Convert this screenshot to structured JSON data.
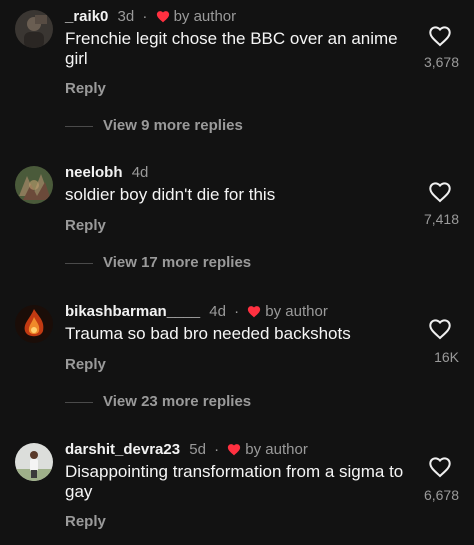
{
  "colors": {
    "background": "#121212",
    "author_heart": "#ff3040",
    "muted": "#9a9a9a"
  },
  "icons": {
    "like": "heart-outline-icon",
    "author_like": "heart-filled-icon"
  },
  "comments": [
    {
      "username": "_raik0",
      "time": "3d",
      "separator": "·",
      "by_author": "by author",
      "text": "Frenchie legit chose the BBC over an anime girl",
      "likes": "3,678",
      "reply": "Reply",
      "view_more": "View 9 more replies"
    },
    {
      "username": "neelobh",
      "time": "4d",
      "text": "soldier boy didn't die for this",
      "likes": "7,418",
      "reply": "Reply",
      "view_more": "View 17 more replies"
    },
    {
      "username": "bikashbarman____",
      "time": "4d",
      "separator": "·",
      "by_author": "by author",
      "text": "Trauma so bad bro needed backshots",
      "likes": "16K",
      "reply": "Reply",
      "view_more": "View 23 more replies"
    },
    {
      "username": "darshit_devra23",
      "time": "5d",
      "separator": "·",
      "by_author": "by author",
      "text": "Disappointing transformation from a sigma to gay",
      "likes": "6,678",
      "reply": "Reply"
    }
  ]
}
